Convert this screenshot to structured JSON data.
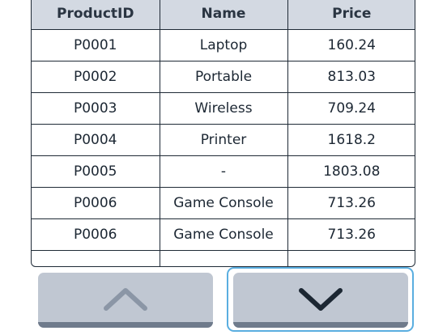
{
  "table": {
    "headers": [
      "ProductID",
      "Name",
      "Price"
    ],
    "rows": [
      [
        "P0001",
        "Laptop",
        "160.24"
      ],
      [
        "P0002",
        "Portable",
        "813.03"
      ],
      [
        "P0003",
        "Wireless",
        "709.24"
      ],
      [
        "P0004",
        "Printer",
        "1618.2"
      ],
      [
        "P0005",
        "-",
        "1803.08"
      ],
      [
        "P0006",
        "Game Console",
        "713.26"
      ],
      [
        "P0006",
        "Game Console",
        "713.26"
      ]
    ]
  },
  "controls": {
    "scroll_up_icon": "chevron-up",
    "scroll_down_icon": "chevron-down",
    "focused": "scroll_down"
  },
  "colors": {
    "header_bg": "#d3d9e2",
    "button_bg": "#c0c7d2",
    "button_shadow": "#6f7b8c",
    "focus_ring": "#5aaee0",
    "border": "#1f2a36"
  }
}
